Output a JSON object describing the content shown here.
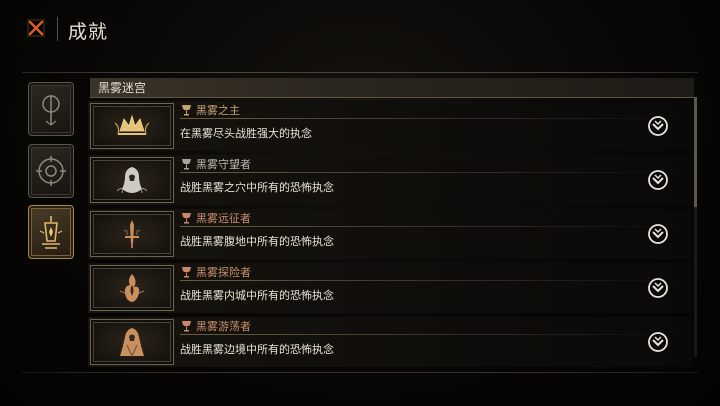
{
  "header": {
    "title": "成就",
    "close_icon": "close-x-icon"
  },
  "categories": [
    {
      "icon": "staff-sigil-icon",
      "active": false
    },
    {
      "icon": "target-rune-icon",
      "active": false
    },
    {
      "icon": "lantern-emblem-icon",
      "active": true
    }
  ],
  "section": {
    "title": "黑雾迷宫"
  },
  "achievements": [
    {
      "name": "黑雾之主",
      "desc": "在黑雾尽头战胜强大的执念",
      "icon": "crown-crest-icon"
    },
    {
      "name": "黑雾守望者",
      "desc": "战胜黑雾之穴中所有的恐怖执念",
      "icon": "hooded-figure-icon"
    },
    {
      "name": "黑雾远征者",
      "desc": "战胜黑雾腹地中所有的恐怖执念",
      "icon": "sword-emblem-icon"
    },
    {
      "name": "黑雾探险者",
      "desc": "战胜黑雾内城中所有的恐怖执念",
      "icon": "flame-sigil-icon"
    },
    {
      "name": "黑雾游荡者",
      "desc": "战胜黑雾边境中所有的恐怖执念",
      "icon": "cloaked-wanderer-icon"
    }
  ],
  "colors": {
    "accent": "#c4a274",
    "active_frame": "#a88650",
    "close": "#e05a2a"
  }
}
